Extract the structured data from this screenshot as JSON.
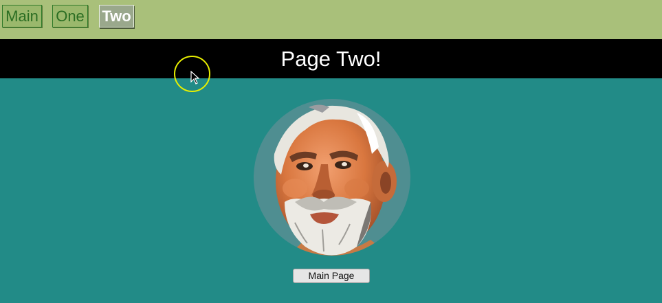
{
  "nav": {
    "items": [
      {
        "label": "Main"
      },
      {
        "label": "One"
      },
      {
        "label": "Two"
      }
    ],
    "active": "Two"
  },
  "header": {
    "title": "Page Two!"
  },
  "content": {
    "image": "portrait-illustration",
    "button_label": "Main Page"
  },
  "colors": {
    "nav_bg": "#a9c07a",
    "header_bg": "#000000",
    "content_bg": "#228b87",
    "cursor_highlight": "#e9f000"
  }
}
